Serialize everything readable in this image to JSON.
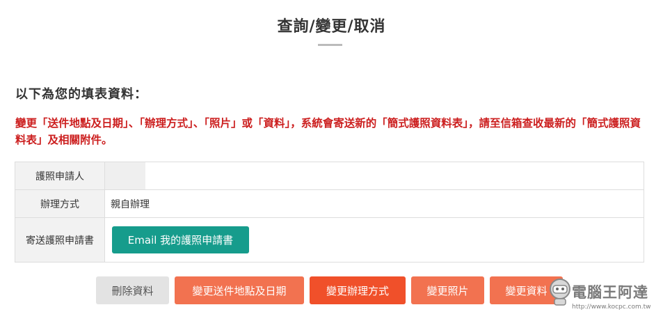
{
  "header": {
    "title": "查詢/變更/取消"
  },
  "section": {
    "heading": "以下為您的填表資料："
  },
  "notice": {
    "text": "變更「送件地點及日期」、「辦理方式」、「照片」或「資料」，系統會寄送新的「簡式護照資料表」，請至信箱查收最新的「簡式護照資料表」及相關附件。"
  },
  "table": {
    "rows": [
      {
        "label": "護照申請人",
        "value": ""
      },
      {
        "label": "辦理方式",
        "value": "親自辦理"
      },
      {
        "label": "寄送護照申請書",
        "button": "Email 我的護照申請書"
      }
    ]
  },
  "actions": {
    "delete": "刪除資料",
    "change_location_date": "變更送件地點及日期",
    "change_method": "變更辦理方式",
    "change_photo": "變更照片",
    "change_data": "變更資料"
  },
  "watermark": {
    "name": "電腦王阿達",
    "url": "http://www.kocpc.com.tw"
  },
  "colors": {
    "notice_red": "#cc1f1f",
    "teal_button": "#169c8c",
    "orange_button": "#f27250",
    "active_orange": "#f0502a",
    "gray_button": "#e3e3e3"
  }
}
